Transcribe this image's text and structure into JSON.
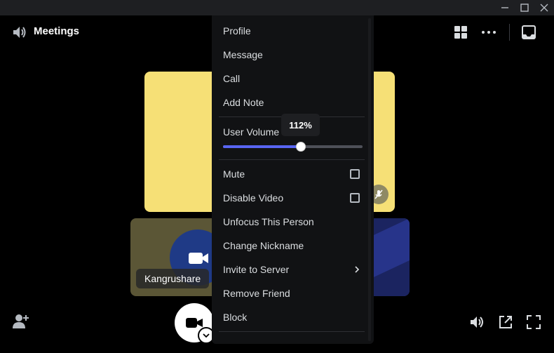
{
  "window": {
    "controls": [
      "minimize-icon",
      "maximize-icon",
      "close-icon"
    ]
  },
  "header": {
    "title": "Meetings",
    "icons": [
      "speaker-icon",
      "grid-icon",
      "more-icon",
      "inbox-icon"
    ]
  },
  "participant": {
    "name": "Kangrushare"
  },
  "context_menu": {
    "items_top": [
      {
        "label": "Profile"
      },
      {
        "label": "Message"
      },
      {
        "label": "Call"
      },
      {
        "label": "Add Note"
      }
    ],
    "volume": {
      "label": "User Volume",
      "value_text": "112%",
      "fraction": 0.56
    },
    "items_mid": [
      {
        "label": "Mute",
        "checked": false
      },
      {
        "label": "Disable Video",
        "checked": false
      },
      {
        "label": "Unfocus This Person"
      },
      {
        "label": "Change Nickname"
      },
      {
        "label": "Invite to Server",
        "submenu": true
      },
      {
        "label": "Remove Friend"
      },
      {
        "label": "Block"
      }
    ]
  },
  "colors": {
    "accent": "#5865f2",
    "menu_bg": "#111214",
    "tile_yellow": "#f6e076"
  }
}
